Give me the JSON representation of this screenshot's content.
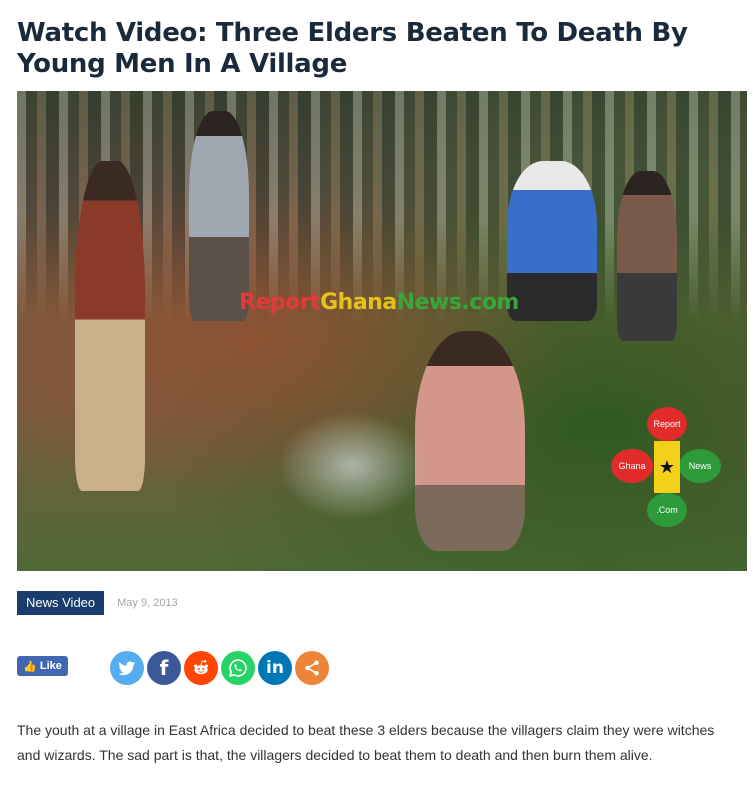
{
  "article": {
    "title": "Watch Video: Three Elders Beaten To Death By Young Men In A Village",
    "category": "News Video",
    "date": "May 9, 2013",
    "body": "The youth at a village in East Africa decided to beat these 3 elders because the villagers claim they were witches and wizards. The sad part is that, the villagers decided to beat them to death and then burn them alive."
  },
  "image": {
    "watermark_parts": [
      "Report",
      "Ghana",
      "News.com"
    ],
    "logo": {
      "top": "Report",
      "left": "Ghana",
      "right": "News",
      "bottom": ".Com"
    }
  },
  "social": {
    "like_label": "Like",
    "buttons": [
      {
        "name": "twitter",
        "icon": "twitter-icon",
        "color": "#55acee"
      },
      {
        "name": "facebook",
        "icon": "facebook-icon",
        "color": "#3b5998"
      },
      {
        "name": "reddit",
        "icon": "reddit-icon",
        "color": "#ff4500"
      },
      {
        "name": "whatsapp",
        "icon": "whatsapp-icon",
        "color": "#25d366"
      },
      {
        "name": "linkedin",
        "icon": "linkedin-icon",
        "color": "#0077b5"
      },
      {
        "name": "share",
        "icon": "share-icon",
        "color": "#f0833a"
      }
    ]
  }
}
